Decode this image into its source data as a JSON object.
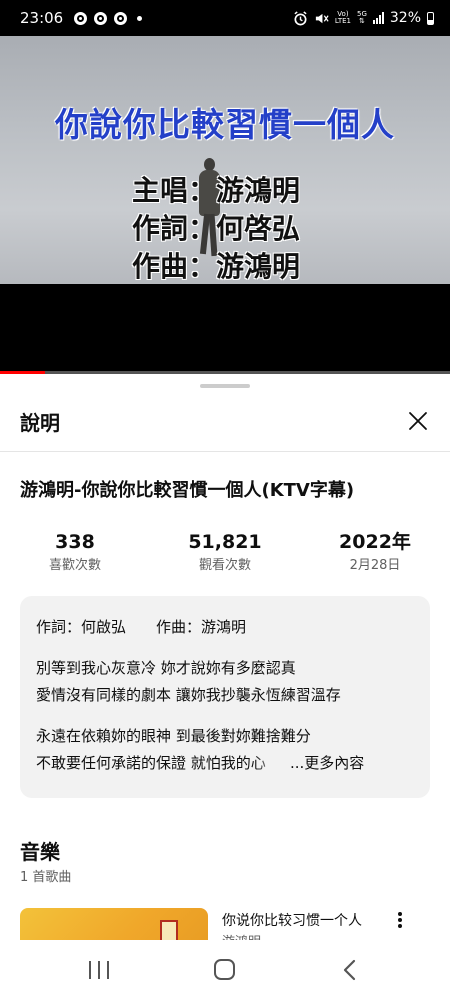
{
  "status_bar": {
    "time": "23:06",
    "network_top": "Vo)",
    "network_bottom": "LTE1",
    "network_5g": "5G",
    "battery": "32%"
  },
  "video": {
    "title_overlay": "你說你比較習慣一個人",
    "credits": [
      "主唱：游鴻明",
      "作詞：何啓弘",
      "作曲：游鴻明"
    ],
    "progress": 0.1
  },
  "sheet": {
    "title": "說明",
    "video_name": "游鴻明-你說你比較習慣一個人(KTV字幕)",
    "stats": [
      {
        "value": "338",
        "label": "喜歡次數"
      },
      {
        "value": "51,821",
        "label": "觀看次數"
      },
      {
        "value": "2022年",
        "label": "2月28日"
      }
    ],
    "description": {
      "credits_line": "作詞：何啟弘　　作曲：游鴻明",
      "lines": [
        "別等到我心灰意冷 妳才說妳有多麼認真",
        "愛情沒有同樣的劇本 讓妳我抄襲永恆練習溫存",
        "永遠在依賴妳的眼神 到最後對妳難捨難分",
        "不敢要任何承諾的保證 就怕我的心"
      ],
      "more": "...更多內容"
    },
    "music": {
      "heading": "音樂",
      "count": "1 首歌曲",
      "song_title": "你说你比较习惯一个人",
      "song_artist": "游鸿明"
    }
  },
  "colors": {
    "overlay_title": "#2440c8",
    "progress": "#ff0000",
    "desc_bg": "#f2f2f2"
  }
}
